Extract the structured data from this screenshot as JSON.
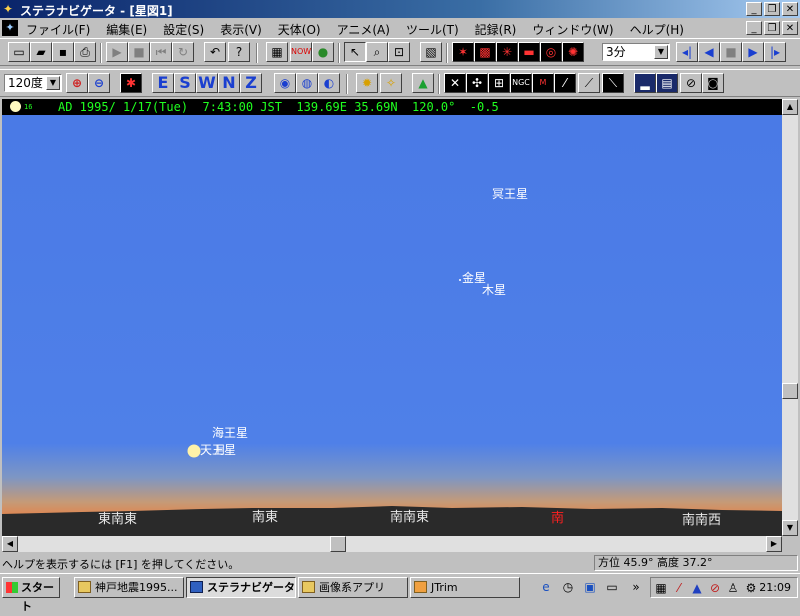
{
  "window": {
    "title": "ステラナビゲータ - [星図1]"
  },
  "menu": [
    "ファイル(F)",
    "編集(E)",
    "設定(S)",
    "表示(V)",
    "天体(O)",
    "アニメ(A)",
    "ツール(T)",
    "記録(R)",
    "ウィンドウ(W)",
    "ヘルプ(H)"
  ],
  "toolbar": {
    "interval": "3分",
    "fov": "120度",
    "directions": [
      "E",
      "S",
      "W",
      "N",
      "Z"
    ]
  },
  "info": {
    "moon_age": "16",
    "text": "AD 1995/ 1/17(Tue)  7:43:00 JST  139.69E 35.69N  120.0°  -0.5"
  },
  "sky": {
    "labels": {
      "pluto": "冥王星",
      "venus": "金星",
      "jupiter": "木星",
      "neptune": "海王星",
      "uranus": "天王星",
      "moon": "月"
    },
    "horizon": [
      "東南東",
      "南東",
      "南南東",
      "南",
      "南南西"
    ],
    "south_color": "#ff2020",
    "moon_color": "#fff2a8"
  },
  "status": {
    "help": "ヘルプを表示するには [F1] を押してください。",
    "position": "方位  45.9° 高度  37.2°"
  },
  "taskbar": {
    "start": "スタート",
    "tasks": [
      "神戸地震1995...",
      "ステラナビゲータ...",
      "画像系アプリ",
      "JTrim"
    ],
    "clock": "21:09"
  }
}
